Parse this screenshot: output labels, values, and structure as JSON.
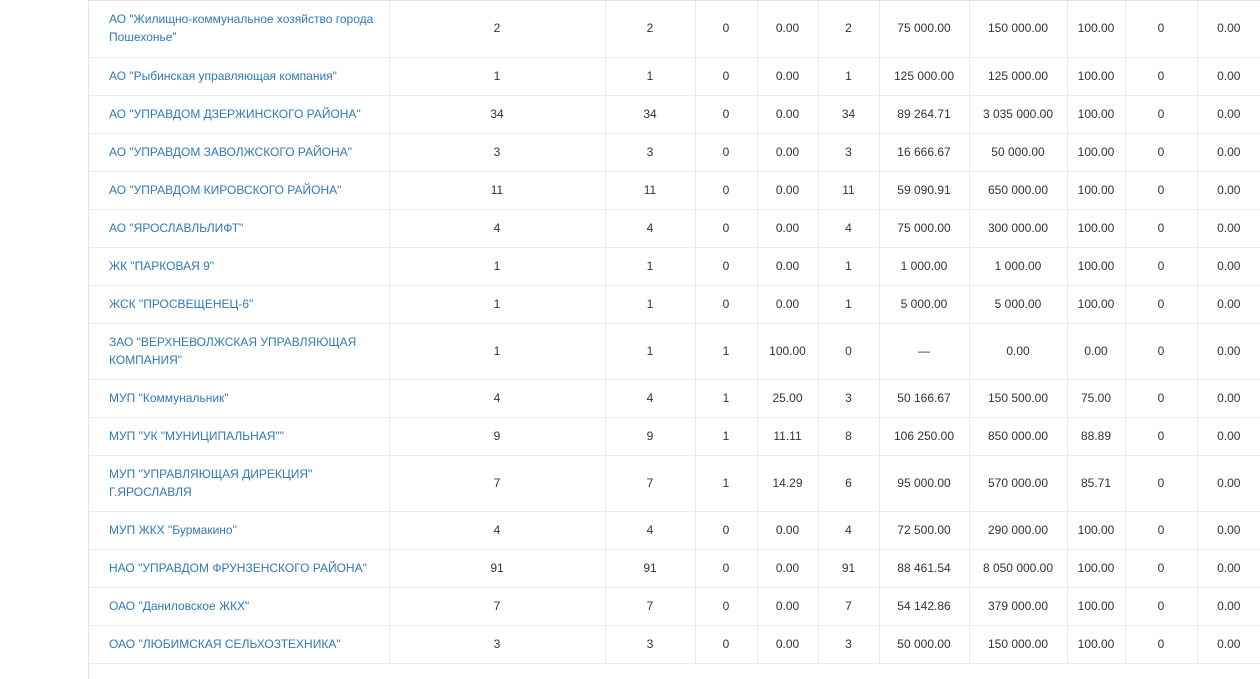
{
  "table": {
    "rows": [
      {
        "name": "АО \"Жилищно-коммунальное хозяйство города Пошехонье\"",
        "two_line": true,
        "cells": [
          "2",
          "2",
          "0",
          "0.00",
          "2",
          "75 000.00",
          "150 000.00",
          "100.00",
          "0",
          "0.00"
        ]
      },
      {
        "name": "АО \"Рыбинская управляющая компания\"",
        "two_line": false,
        "cells": [
          "1",
          "1",
          "0",
          "0.00",
          "1",
          "125 000.00",
          "125 000.00",
          "100.00",
          "0",
          "0.00"
        ]
      },
      {
        "name": "АО \"УПРАВДОМ ДЗЕРЖИНСКОГО РАЙОНА\"",
        "two_line": false,
        "cells": [
          "34",
          "34",
          "0",
          "0.00",
          "34",
          "89 264.71",
          "3 035 000.00",
          "100.00",
          "0",
          "0.00"
        ]
      },
      {
        "name": "АО \"УПРАВДОМ ЗАВОЛЖСКОГО РАЙОНА\"",
        "two_line": false,
        "cells": [
          "3",
          "3",
          "0",
          "0.00",
          "3",
          "16 666.67",
          "50 000.00",
          "100.00",
          "0",
          "0.00"
        ]
      },
      {
        "name": "АО \"УПРАВДОМ КИРОВСКОГО РАЙОНА\"",
        "two_line": false,
        "cells": [
          "11",
          "11",
          "0",
          "0.00",
          "11",
          "59 090.91",
          "650 000.00",
          "100.00",
          "0",
          "0.00"
        ]
      },
      {
        "name": "АО \"ЯРОСЛАВЛЬЛИФТ\"",
        "two_line": false,
        "cells": [
          "4",
          "4",
          "0",
          "0.00",
          "4",
          "75 000.00",
          "300 000.00",
          "100.00",
          "0",
          "0.00"
        ]
      },
      {
        "name": "ЖК \"ПАРКОВАЯ 9\"",
        "two_line": false,
        "cells": [
          "1",
          "1",
          "0",
          "0.00",
          "1",
          "1 000.00",
          "1 000.00",
          "100.00",
          "0",
          "0.00"
        ]
      },
      {
        "name": "ЖСК \"ПРОСВЕЩЕНЕЦ-6\"",
        "two_line": false,
        "cells": [
          "1",
          "1",
          "0",
          "0.00",
          "1",
          "5 000.00",
          "5 000.00",
          "100.00",
          "0",
          "0.00"
        ]
      },
      {
        "name": "ЗАО \"ВЕРХНЕВОЛЖСКАЯ УПРАВЛЯЮЩАЯ КОМПАНИЯ\"",
        "two_line": true,
        "cells": [
          "1",
          "1",
          "1",
          "100.00",
          "0",
          "—",
          "0.00",
          "0.00",
          "0",
          "0.00"
        ]
      },
      {
        "name": "МУП \"Коммунальник\"",
        "two_line": false,
        "cells": [
          "4",
          "4",
          "1",
          "25.00",
          "3",
          "50 166.67",
          "150 500.00",
          "75.00",
          "0",
          "0.00"
        ]
      },
      {
        "name": "МУП \"УК \"МУНИЦИПАЛЬНАЯ\"\"",
        "two_line": false,
        "cells": [
          "9",
          "9",
          "1",
          "11.11",
          "8",
          "106 250.00",
          "850 000.00",
          "88.89",
          "0",
          "0.00"
        ]
      },
      {
        "name": "МУП \"УПРАВЛЯЮЩАЯ ДИРЕКЦИЯ\" Г.ЯРОСЛАВЛЯ",
        "two_line": true,
        "cells": [
          "7",
          "7",
          "1",
          "14.29",
          "6",
          "95 000.00",
          "570 000.00",
          "85.71",
          "0",
          "0.00"
        ]
      },
      {
        "name": "МУП ЖКХ \"Бурмакино\"",
        "two_line": false,
        "cells": [
          "4",
          "4",
          "0",
          "0.00",
          "4",
          "72 500.00",
          "290 000.00",
          "100.00",
          "0",
          "0.00"
        ]
      },
      {
        "name": "НАО \"УПРАВДОМ ФРУНЗЕНСКОГО РАЙОНА\"",
        "two_line": false,
        "cells": [
          "91",
          "91",
          "0",
          "0.00",
          "91",
          "88 461.54",
          "8 050 000.00",
          "100.00",
          "0",
          "0.00"
        ]
      },
      {
        "name": "ОАО \"Даниловское ЖКХ\"",
        "two_line": false,
        "cells": [
          "7",
          "7",
          "0",
          "0.00",
          "7",
          "54 142.86",
          "379 000.00",
          "100.00",
          "0",
          "0.00"
        ]
      },
      {
        "name": "ОАО \"ЛЮБИМСКАЯ СЕЛЬХОЗТЕХНИКА\"",
        "two_line": false,
        "cells": [
          "3",
          "3",
          "0",
          "0.00",
          "3",
          "50 000.00",
          "150 000.00",
          "100.00",
          "0",
          "0.00"
        ]
      }
    ]
  },
  "colors": {
    "link": "#2f7ab8",
    "text": "#333333",
    "border": "#eaeaea"
  }
}
